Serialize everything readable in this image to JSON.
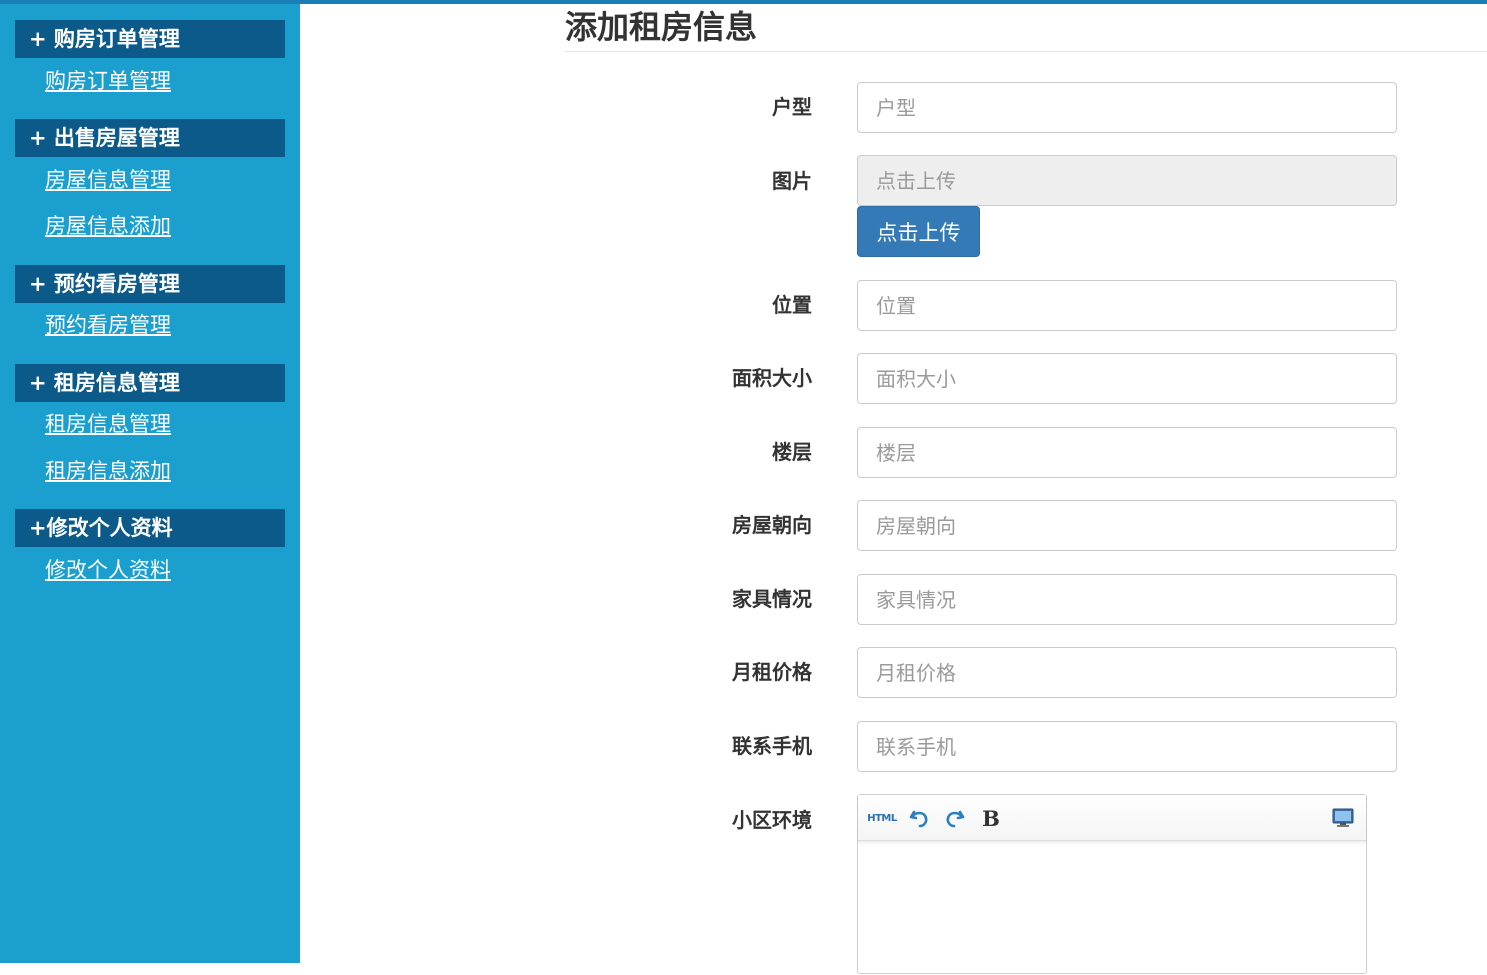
{
  "sidebar": {
    "groups": [
      {
        "header": "+ 购房订单管理",
        "links": [
          "购房订单管理"
        ]
      },
      {
        "header": "+ 出售房屋管理",
        "links": [
          "房屋信息管理",
          "房屋信息添加"
        ]
      },
      {
        "header": "+ 预约看房管理",
        "links": [
          "预约看房管理"
        ]
      },
      {
        "header": "+ 租房信息管理",
        "links": [
          "租房信息管理",
          "租房信息添加"
        ]
      },
      {
        "header": "+修改个人资料",
        "links": [
          "修改个人资料"
        ]
      }
    ]
  },
  "main": {
    "title": "添加租房信息",
    "fields": {
      "huxing": {
        "label": "户型",
        "placeholder": "户型"
      },
      "image": {
        "label": "图片",
        "placeholder": "点击上传",
        "button": "点击上传"
      },
      "location": {
        "label": "位置",
        "placeholder": "位置"
      },
      "area": {
        "label": "面积大小",
        "placeholder": "面积大小"
      },
      "floor": {
        "label": "楼层",
        "placeholder": "楼层"
      },
      "orientation": {
        "label": "房屋朝向",
        "placeholder": "房屋朝向"
      },
      "furniture": {
        "label": "家具情况",
        "placeholder": "家具情况"
      },
      "rent": {
        "label": "月租价格",
        "placeholder": "月租价格"
      },
      "phone": {
        "label": "联系手机",
        "placeholder": "联系手机"
      },
      "environment": {
        "label": "小区环境"
      }
    },
    "editor": {
      "html_label": "HTML",
      "bold_label": "B",
      "icons": [
        "html-icon",
        "undo-icon",
        "redo-icon",
        "bold-icon",
        "fullscreen-icon"
      ]
    }
  },
  "colors": {
    "sidebar_bg": "#1b9fcf",
    "group_header_bg": "#0b5a8a",
    "primary_button": "#337ab7"
  }
}
